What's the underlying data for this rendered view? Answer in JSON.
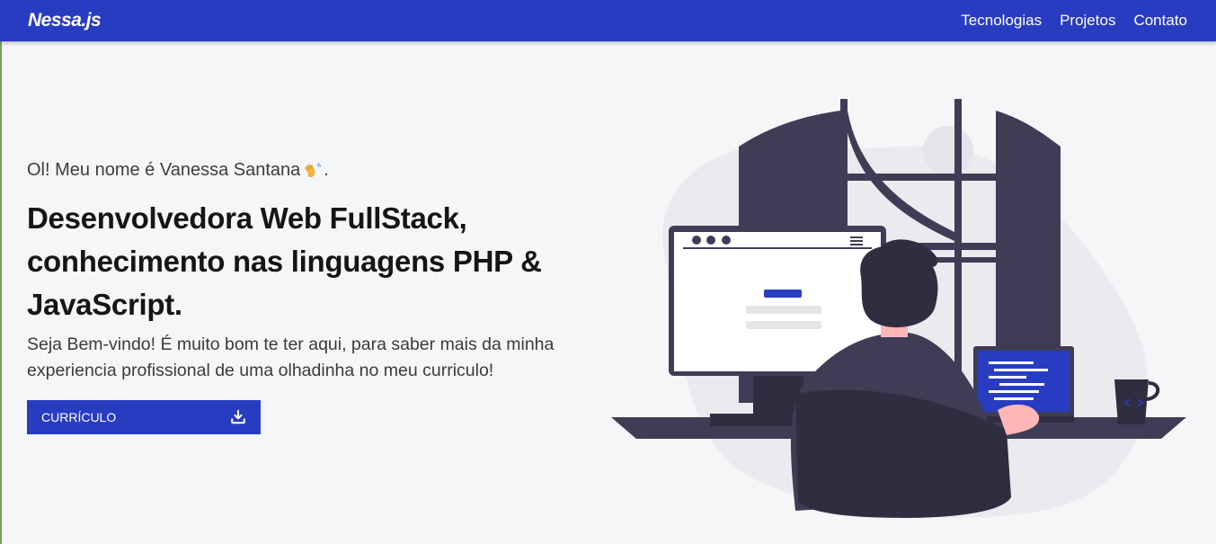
{
  "nav": {
    "brand": "Nessa.js",
    "links": [
      "Tecnologias",
      "Projetos",
      "Contato"
    ]
  },
  "hero": {
    "greeting": "Ol! Meu nome é Vanessa Santana",
    "greeting_suffix": ".",
    "greeting_icon": "waving-hand-icon",
    "headline_lines": [
      "Desenvolvedora Web FullStack,",
      "conhecimento nas linguagens PHP &",
      "JavaScript."
    ],
    "intro": "Seja Bem-vindo! É muito bom te ter aqui, para saber mais da minha experiencia profissional de uma olhadinha no meu curriculo!",
    "button_label": "Currículo",
    "button_icon": "download-icon"
  },
  "colors": {
    "primary": "#283cc2",
    "background": "#f5f6f8",
    "illustration_dark": "#3f3d56",
    "illustration_skin": "#ffb6b6"
  }
}
